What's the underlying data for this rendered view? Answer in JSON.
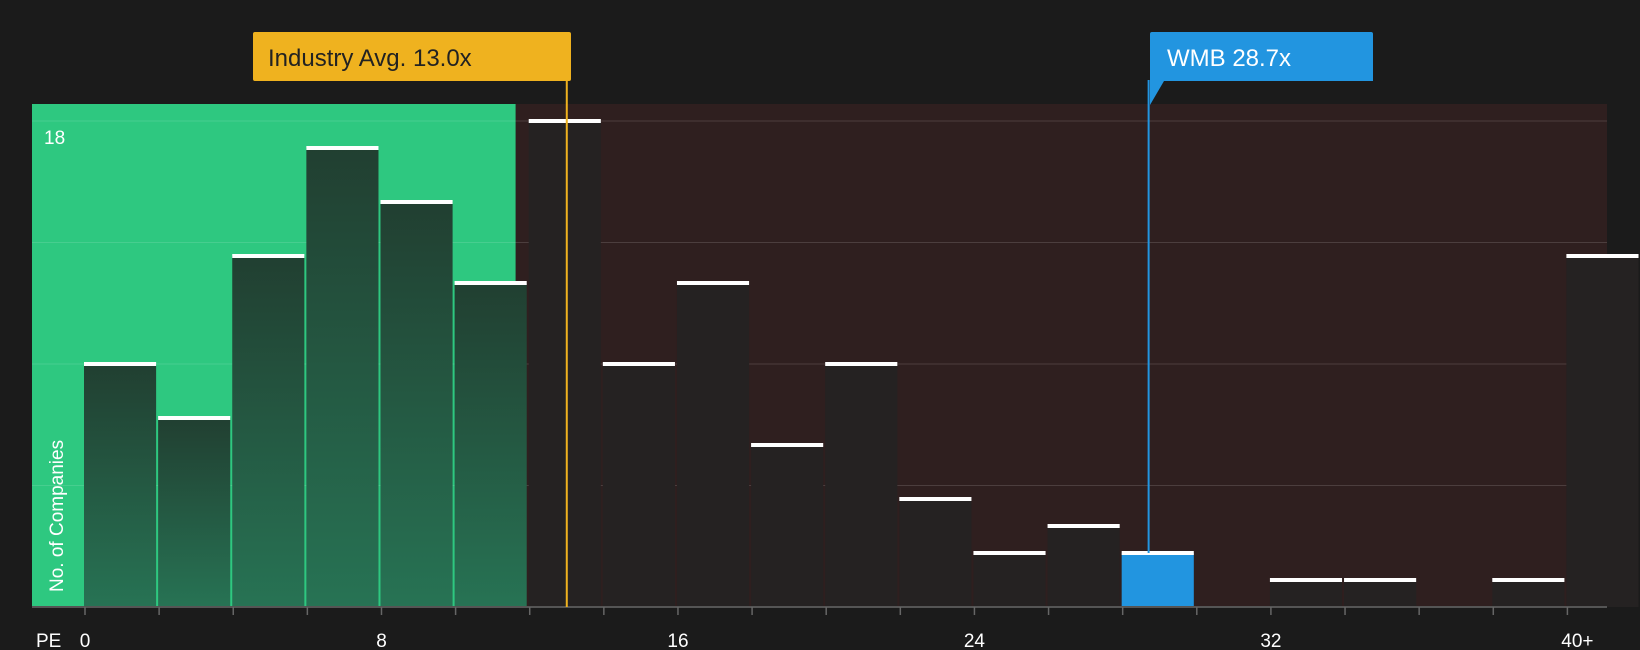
{
  "chart_data": {
    "type": "bar",
    "xlabel": "PE",
    "ylabel": "No. of Companies",
    "x_ticks": [
      "0",
      "8",
      "16",
      "24",
      "32",
      "40+"
    ],
    "y_ticks": [
      "18"
    ],
    "ylim": [
      0,
      18
    ],
    "bins": [
      {
        "from": 0,
        "to": 2,
        "value": 9
      },
      {
        "from": 2,
        "to": 4,
        "value": 7
      },
      {
        "from": 4,
        "to": 6,
        "value": 13
      },
      {
        "from": 6,
        "to": 8,
        "value": 17
      },
      {
        "from": 8,
        "to": 10,
        "value": 15
      },
      {
        "from": 10,
        "to": 12,
        "value": 12
      },
      {
        "from": 12,
        "to": 14,
        "value": 18
      },
      {
        "from": 14,
        "to": 16,
        "value": 9
      },
      {
        "from": 16,
        "to": 18,
        "value": 12
      },
      {
        "from": 18,
        "to": 20,
        "value": 6
      },
      {
        "from": 20,
        "to": 22,
        "value": 9
      },
      {
        "from": 22,
        "to": 24,
        "value": 4
      },
      {
        "from": 24,
        "to": 26,
        "value": 2
      },
      {
        "from": 26,
        "to": 28,
        "value": 3
      },
      {
        "from": 28,
        "to": 30,
        "value": 2
      },
      {
        "from": 30,
        "to": 32,
        "value": 0
      },
      {
        "from": 32,
        "to": 34,
        "value": 1
      },
      {
        "from": 34,
        "to": 36,
        "value": 1
      },
      {
        "from": 36,
        "to": 38,
        "value": 0
      },
      {
        "from": 38,
        "to": 40,
        "value": 1
      },
      {
        "from": 40,
        "to": 42,
        "value": 13
      }
    ],
    "industry_avg": {
      "label": "Industry Avg. 13.0x",
      "value": 13.0
    },
    "company": {
      "label": "WMB 28.7x",
      "value": 28.7
    },
    "colors": {
      "background": "#1b1b1b",
      "undervalued_zone": "#2ec880",
      "overvalued_zone": "#2f1f1f",
      "industry_callout": "#efb21f",
      "company_callout": "#2295e0",
      "bar_dark": "#252222",
      "bar_green_dark": "#224537",
      "bar_cap": "#ffffff"
    }
  }
}
